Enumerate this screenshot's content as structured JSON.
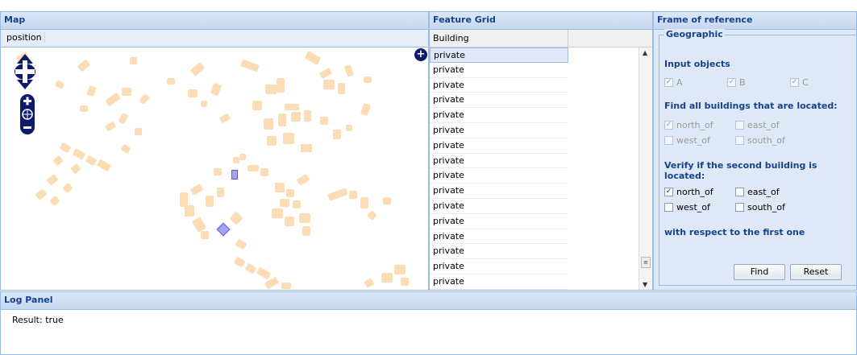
{
  "map": {
    "title": "Map",
    "toolbar_position": "position",
    "layer_switcher_icon": "plus-icon",
    "zoom_in_icon": "plus-icon",
    "zoom_out_icon": "minus-icon",
    "zoom_world_icon": "globe-icon",
    "building_color": "#fbdcb4",
    "selected_color": "#a6a3f2"
  },
  "grid": {
    "title": "Feature Grid",
    "column": "Building",
    "rows": [
      "private",
      "private",
      "private",
      "private",
      "private",
      "private",
      "private",
      "private",
      "private",
      "private",
      "private",
      "private",
      "private",
      "private",
      "private",
      "private"
    ]
  },
  "frame": {
    "title": "Frame of reference",
    "legend": "Geographic",
    "input_label": "Input objects",
    "inputs": [
      {
        "label": "A",
        "checked": true
      },
      {
        "label": "B",
        "checked": true
      },
      {
        "label": "C",
        "checked": true
      }
    ],
    "find_label": "Find all buildings that are located:",
    "find_options": [
      {
        "label": "north_of",
        "checked": true
      },
      {
        "label": "east_of",
        "checked": false
      },
      {
        "label": "west_of",
        "checked": false
      },
      {
        "label": "south_of",
        "checked": false
      }
    ],
    "verify_label": "Verify if the second building is located:",
    "verify_options": [
      {
        "label": "north_of",
        "checked": true
      },
      {
        "label": "east_of",
        "checked": false
      },
      {
        "label": "west_of",
        "checked": false
      },
      {
        "label": "south_of",
        "checked": false
      }
    ],
    "respect_label": "with respect to the first one",
    "find_button": "Find",
    "reset_button": "Reset"
  },
  "log": {
    "title": "Log Panel",
    "text": "Result: true"
  },
  "colors": {
    "header_text": "#15428b",
    "border": "#99bbe8",
    "panel_bg": "#dfe8f6"
  }
}
